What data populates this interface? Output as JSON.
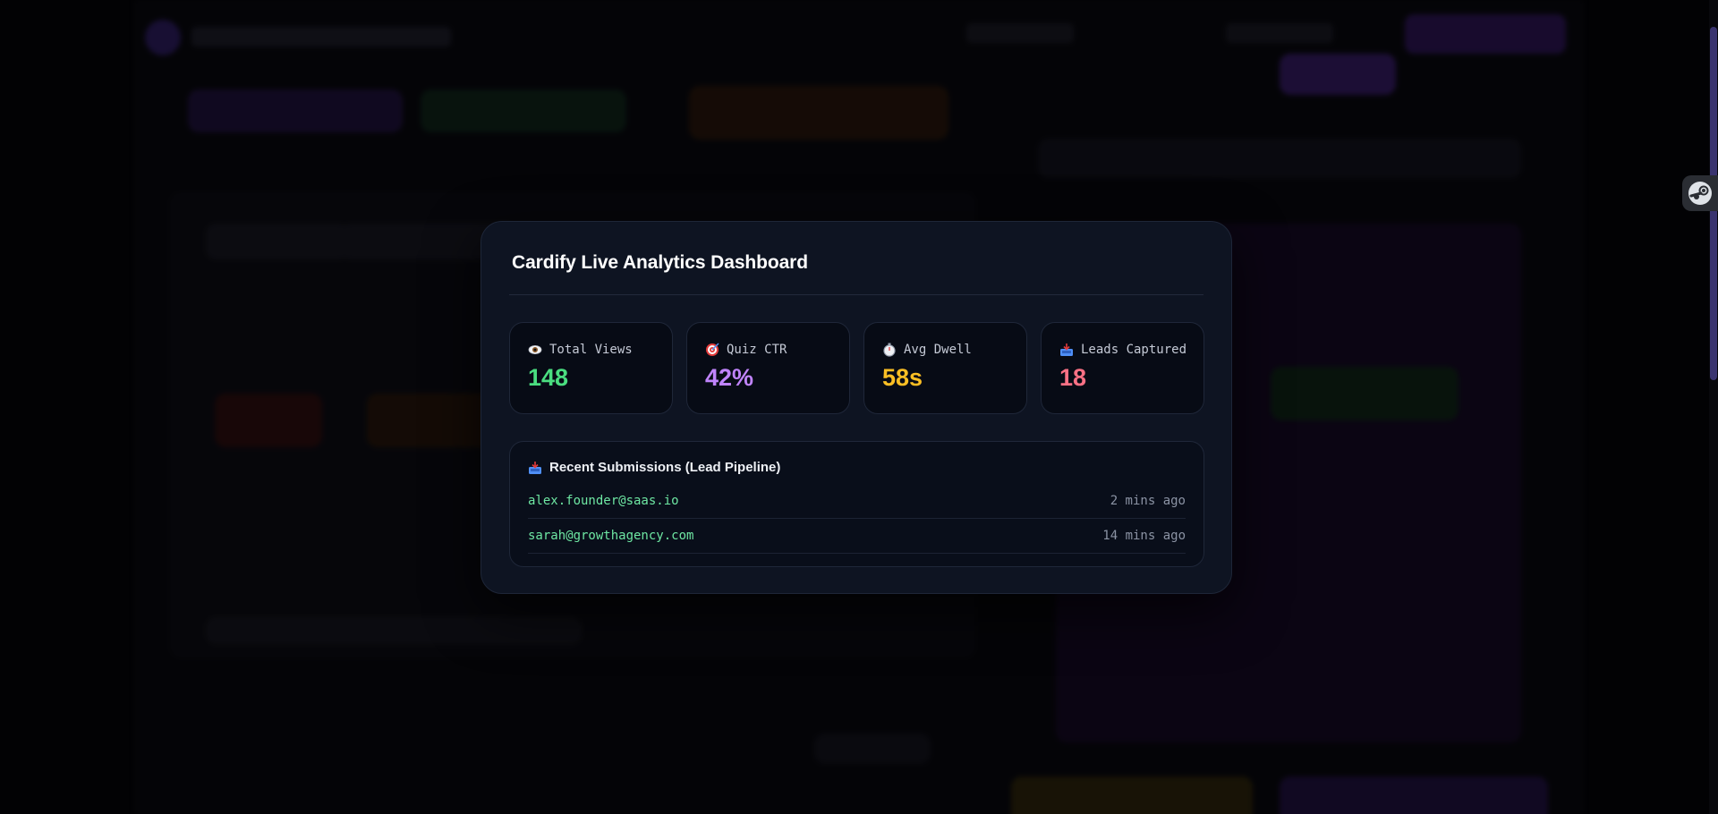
{
  "modal": {
    "title": "Cardify Live Analytics Dashboard"
  },
  "stats": [
    {
      "icon": "eye-icon",
      "label": "Total Views",
      "value": "148",
      "color": "#4ade80"
    },
    {
      "icon": "target-icon",
      "label": "Quiz CTR",
      "value": "42%",
      "color": "#c084fc"
    },
    {
      "icon": "stopwatch-icon",
      "label": "Avg Dwell",
      "value": "58s",
      "color": "#fbbf24"
    },
    {
      "icon": "inbox-tray-icon",
      "label": "Leads Captured",
      "value": "18",
      "color": "#fb7185"
    }
  ],
  "pipeline": {
    "icon": "inbox-tray-icon",
    "title": "Recent Submissions (Lead Pipeline)",
    "rows": [
      {
        "email": "alex.founder@saas.io",
        "time": "2 mins ago"
      },
      {
        "email": "sarah@growthagency.com",
        "time": "14 mins ago"
      }
    ]
  },
  "colors": {
    "modal_bg": "#0e1422",
    "card_bg": "#070b15",
    "email": "#6ee7a3",
    "accent_scroll": "#3a3470"
  }
}
